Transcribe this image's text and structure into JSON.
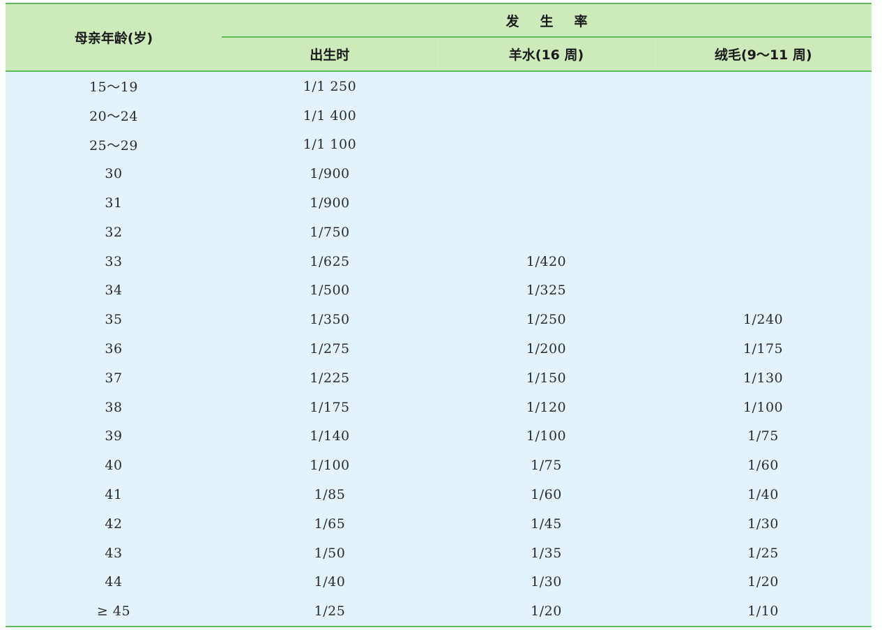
{
  "headers": {
    "age": "母亲年龄(岁)",
    "group": "发生率",
    "sub": [
      "出生时",
      "羊水(16 周)",
      "绒毛(9～11 周)"
    ]
  },
  "rows": [
    [
      "15～19",
      "1/1 250",
      "",
      ""
    ],
    [
      "20～24",
      "1/1 400",
      "",
      ""
    ],
    [
      "25～29",
      "1/1 100",
      "",
      ""
    ],
    [
      "30",
      "1/900",
      "",
      ""
    ],
    [
      "31",
      "1/900",
      "",
      ""
    ],
    [
      "32",
      "1/750",
      "",
      ""
    ],
    [
      "33",
      "1/625",
      "1/420",
      ""
    ],
    [
      "34",
      "1/500",
      "1/325",
      ""
    ],
    [
      "35",
      "1/350",
      "1/250",
      "1/240"
    ],
    [
      "36",
      "1/275",
      "1/200",
      "1/175"
    ],
    [
      "37",
      "1/225",
      "1/150",
      "1/130"
    ],
    [
      "38",
      "1/175",
      "1/120",
      "1/100"
    ],
    [
      "39",
      "1/140",
      "1/100",
      "1/75"
    ],
    [
      "40",
      "1/100",
      "1/75",
      "1/60"
    ],
    [
      "41",
      "1/85",
      "1/60",
      "1/40"
    ],
    [
      "42",
      "1/65",
      "1/45",
      "1/30"
    ],
    [
      "43",
      "1/50",
      "1/35",
      "1/25"
    ],
    [
      "44",
      "1/40",
      "1/30",
      "1/20"
    ],
    [
      "≥ 45",
      "1/25",
      "1/20",
      "1/10"
    ]
  ],
  "colors": {
    "header_bg": "#cdeabb",
    "body_bg": "#e3f3fb",
    "rule": "#5dbb5a"
  }
}
